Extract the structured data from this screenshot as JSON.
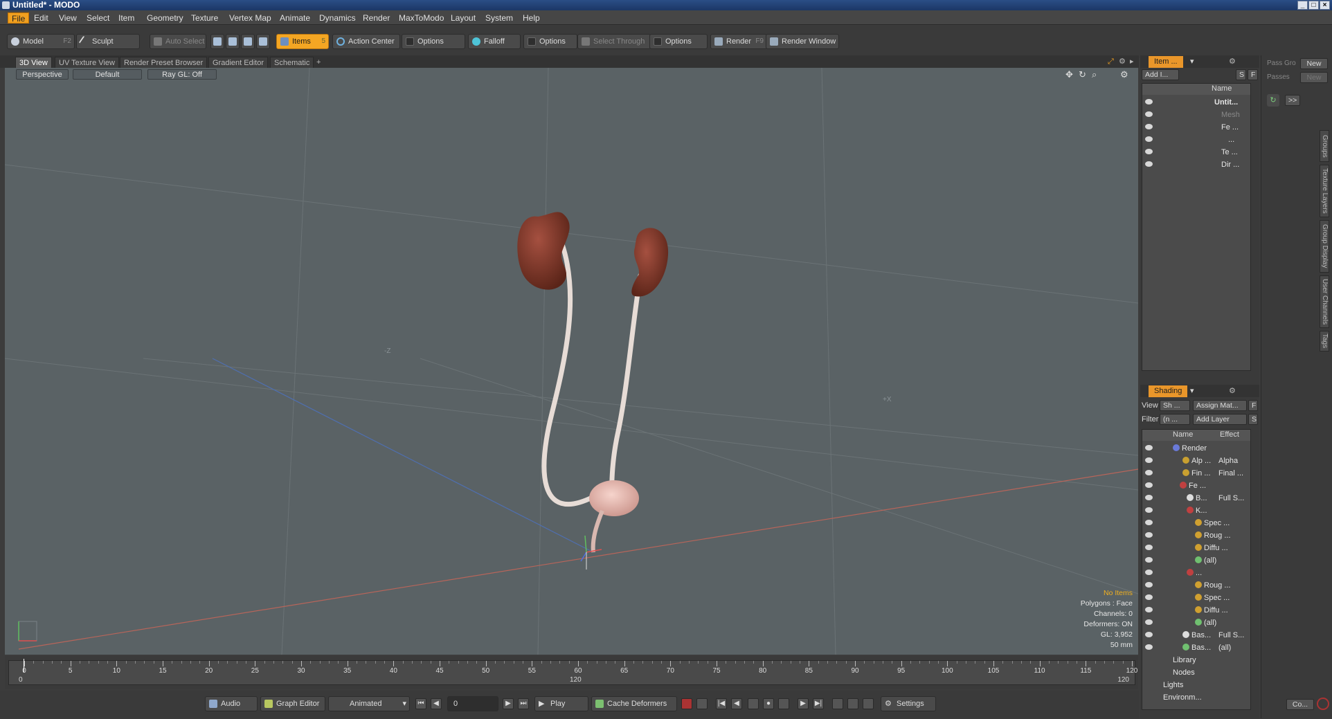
{
  "window": {
    "title": "Untitled* - MODO"
  },
  "menus": [
    "File",
    "Edit",
    "View",
    "Select",
    "Item",
    "Geometry",
    "Texture",
    "Vertex Map",
    "Animate",
    "Dynamics",
    "Render",
    "MaxToModo",
    "Layout",
    "System",
    "Help"
  ],
  "toolbar": {
    "model": "Model",
    "model_key": "F2",
    "sculpt": "Sculpt",
    "auto_select": "Auto Select",
    "items": "Items",
    "items_key": "5",
    "action_center": "Action Center",
    "options1": "Options",
    "falloff": "Falloff",
    "options2": "Options",
    "select_through": "Select Through",
    "options3": "Options",
    "render": "Render",
    "render_key": "F9",
    "render_window": "Render Window"
  },
  "view_tabs": [
    "3D View",
    "UV Texture View",
    "Render Preset Browser",
    "Gradient Editor",
    "Schematic",
    "+"
  ],
  "viewport": {
    "projection": "Perspective",
    "shading": "Default",
    "raygl": "Ray GL: Off",
    "axis_neg_z": "-Z",
    "axis_pos_x": "+X"
  },
  "hud": {
    "selection": "No Items",
    "polygons": "Polygons : Face",
    "channels": "Channels: 0",
    "deformers": "Deformers: ON",
    "gl": "GL: 3,952",
    "size": "50 mm"
  },
  "timeline": {
    "labels": [
      "0",
      "5",
      "10",
      "15",
      "20",
      "25",
      "30",
      "35",
      "40",
      "45",
      "50",
      "55",
      "60",
      "65",
      "70",
      "75",
      "80",
      "85",
      "90",
      "95",
      "100",
      "105",
      "110",
      "115",
      "120"
    ],
    "start": "0",
    "mid": "120",
    "end": "120"
  },
  "bottom": {
    "audio": "Audio",
    "graph_editor": "Graph Editor",
    "mode": "Animated",
    "frame": "0",
    "play": "Play",
    "cache": "Cache Deformers",
    "settings": "Settings"
  },
  "item_panel": {
    "tab": "Item ...",
    "add_item": "Add I...",
    "btn_s": "S",
    "btn_f": "F",
    "name_header": "Name",
    "rows": [
      "Untit...",
      "Mesh",
      "Fe ...",
      "...",
      "Te ...",
      "Dir ..."
    ]
  },
  "shading_panel": {
    "tab": "Shading",
    "view_label": "View",
    "view_value": "Sh ...",
    "assign": "Assign Mat...",
    "btn_f": "F",
    "filter_label": "Filter",
    "filter_value": "(n ...",
    "add_layer": "Add Layer",
    "btn_s": "S",
    "name_header": "Name",
    "effect_header": "Effect",
    "rows": [
      {
        "name": "Render",
        "effect": ""
      },
      {
        "name": "Alp ...",
        "effect": "Alpha"
      },
      {
        "name": "Fin ...",
        "effect": "Final ..."
      },
      {
        "name": "Fe ...",
        "effect": ""
      },
      {
        "name": "B...",
        "effect": "Full S..."
      },
      {
        "name": "K...",
        "effect": ""
      },
      {
        "name": "Spec ...",
        "effect": ""
      },
      {
        "name": "Roug ...",
        "effect": ""
      },
      {
        "name": "Diffu ...",
        "effect": ""
      },
      {
        "name": "(all)",
        "effect": ""
      },
      {
        "name": "...",
        "effect": ""
      },
      {
        "name": "Roug ...",
        "effect": ""
      },
      {
        "name": "Spec ...",
        "effect": ""
      },
      {
        "name": "Diffu ...",
        "effect": ""
      },
      {
        "name": "(all)",
        "effect": ""
      },
      {
        "name": "Bas...",
        "effect": "Full S..."
      },
      {
        "name": "Bas...",
        "effect": "(all)"
      },
      {
        "name": "Library",
        "effect": ""
      },
      {
        "name": "Nodes",
        "effect": ""
      },
      {
        "name": "Lights",
        "effect": ""
      },
      {
        "name": "Environm...",
        "effect": ""
      }
    ]
  },
  "far_right": {
    "pass_groups": "Pass Gro",
    "new1": "New",
    "passes": "Passes",
    "new2": "New",
    "expand": ">>",
    "vertical_tabs": [
      "Groups",
      "Texture Layers",
      "Group Display",
      "User Channels",
      "Tags"
    ],
    "command": "Co..."
  }
}
